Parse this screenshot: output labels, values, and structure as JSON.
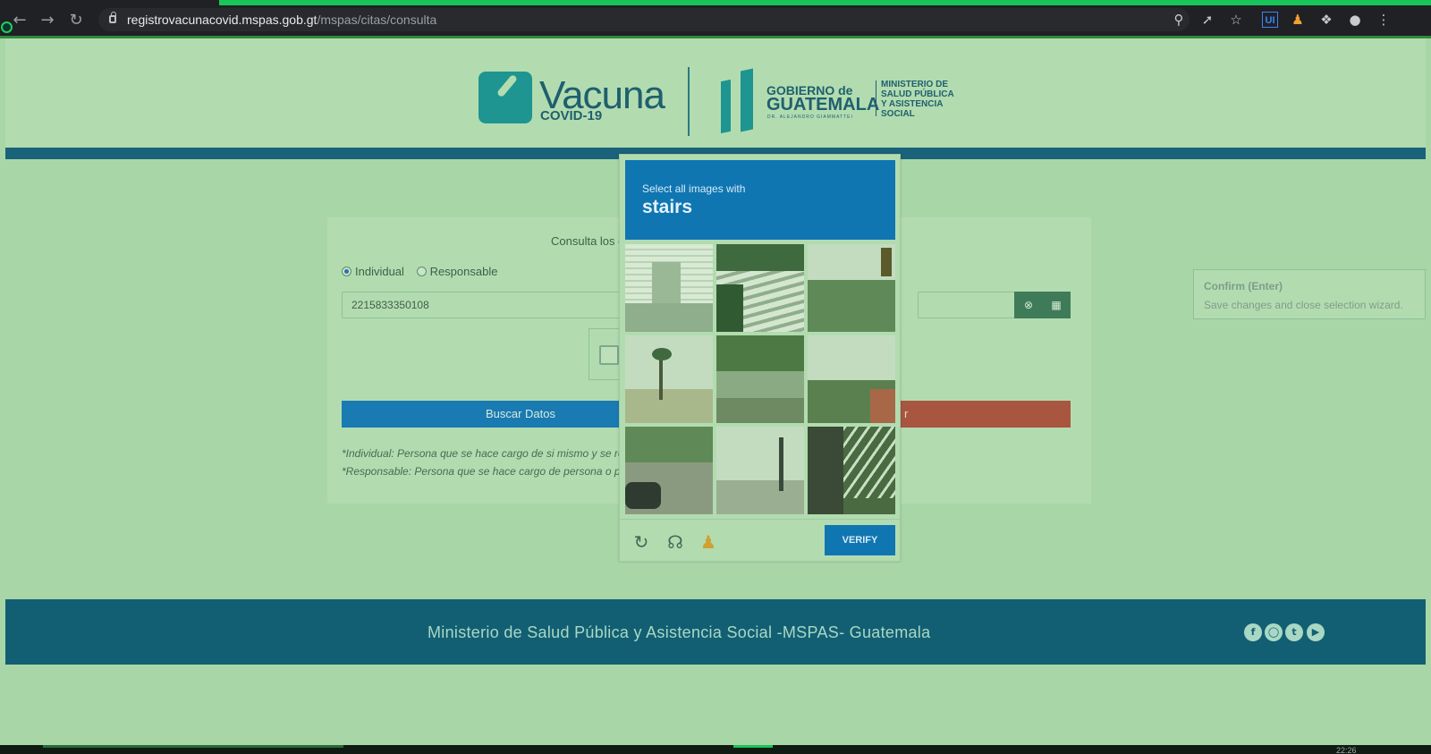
{
  "browser": {
    "url_host": "registrovacunacovid.mspas.gob.gt",
    "url_path": "/mspas/citas/consulta",
    "icons": [
      "back-icon",
      "forward-icon",
      "reload-icon",
      "lock-icon",
      "zoom-icon",
      "share-icon",
      "bookmark-star-icon",
      "ui-extension-icon",
      "person-check-extension-icon",
      "puzzle-extensions-icon",
      "profile-icon",
      "menu-dots-icon"
    ]
  },
  "header": {
    "vacuna": "Vacuna",
    "covid": "COVID-19",
    "gobierno": "GOBIERNO de",
    "guatemala": "GUATEMALA",
    "presidente": "DR. ALEJANDRO GIAMMATTEI",
    "ministry_lines": [
      "MINISTERIO DE",
      "SALUD PÚBLICA",
      "Y ASISTENCIA",
      "SOCIAL"
    ]
  },
  "form": {
    "title": "Consulta los datos",
    "radio_individual": "Individual",
    "radio_responsable": "Responsable",
    "id_value": "2215833350108",
    "btn_buscar": "Buscar Datos",
    "btn_red_partial": "r",
    "note_individual": "*Individual: Persona que se hace cargo de si mismo y se regist",
    "note_responsable": "*Responsable: Persona que se hace cargo de persona o person"
  },
  "tooltip": {
    "title": "Confirm (Enter)",
    "description": "Save changes and close selection wizard."
  },
  "captcha": {
    "prompt": "Select all images with",
    "word": "stairs",
    "verify": "VERIFY",
    "icons": [
      "refresh-icon",
      "headphones-icon",
      "accessibility-icon"
    ]
  },
  "footer": {
    "text": "Ministerio de Salud Pública y Asistencia Social -MSPAS- Guatemala",
    "social": [
      "facebook-icon",
      "instagram-icon",
      "twitter-icon",
      "youtube-icon"
    ]
  },
  "taskbar": {
    "clock": "22:26"
  }
}
